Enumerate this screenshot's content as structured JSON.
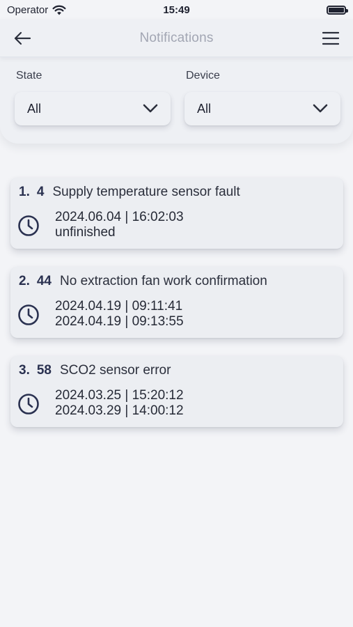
{
  "status_bar": {
    "carrier": "Operator",
    "time": "15:49"
  },
  "header": {
    "title": "Notifications"
  },
  "filters": {
    "state": {
      "label": "State",
      "value": "All"
    },
    "device": {
      "label": "Device",
      "value": "All"
    }
  },
  "notifications": [
    {
      "index": "1.",
      "code": "4",
      "description": "Supply temperature sensor fault",
      "start": "2024.06.04 | 16:02:03",
      "end": "unfinished"
    },
    {
      "index": "2.",
      "code": "44",
      "description": "No extraction fan work confirmation",
      "start": "2024.04.19 | 09:11:41",
      "end": "2024.04.19 | 09:13:55"
    },
    {
      "index": "3.",
      "code": "58",
      "description": "SCO2 sensor error",
      "start": "2024.03.25 | 15:20:12",
      "end": "2024.03.29 | 14:00:12"
    }
  ],
  "icons": {
    "back": "arrow-left-icon",
    "menu": "hamburger-menu-icon",
    "wifi": "wifi-icon",
    "battery": "battery-icon",
    "clock": "clock-icon",
    "dropdown": "chevron-down-icon"
  },
  "colors": {
    "background": "#f3f4f7",
    "card": "#eceef2",
    "accent_text": "#2a3150",
    "title_muted": "#a2a6b3"
  }
}
